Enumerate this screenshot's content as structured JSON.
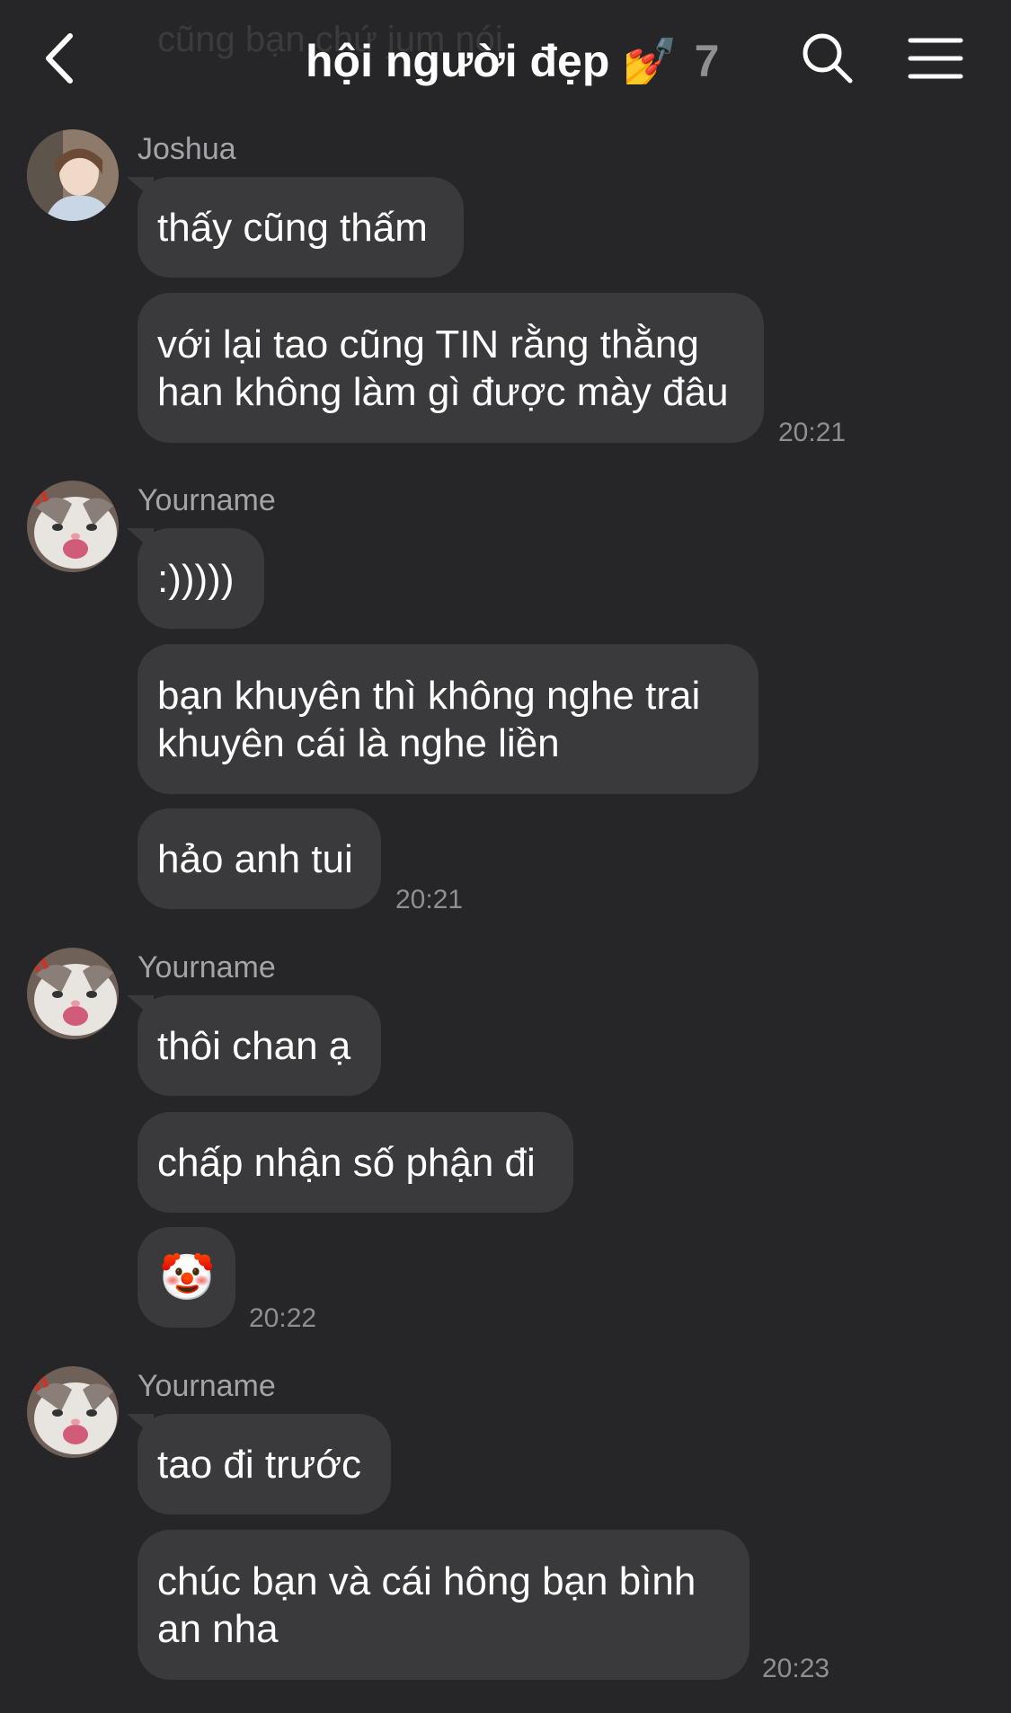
{
  "header": {
    "back_icon": "chevron-left-icon",
    "ghost_text": "cũng bạn chứ jum nói",
    "title": "hội người đẹp",
    "title_emoji": "💅",
    "member_count": "7",
    "search_icon": "search-icon",
    "menu_icon": "hamburger-menu-icon"
  },
  "messages": [
    {
      "sender": "Joshua",
      "bubbles": [
        "thấy cũng thấm",
        "với lại tao cũng TIN rằng thằng han không làm gì được mày đâu"
      ],
      "time": "20:21"
    },
    {
      "sender": "Yourname",
      "bubbles": [
        ":)))))",
        "bạn khuyên thì không nghe trai khuyên cái là nghe liền",
        "hảo anh tui"
      ],
      "time": "20:21"
    },
    {
      "sender": "Yourname",
      "bubbles": [
        "thôi chan ạ",
        "chấp nhận số phận đi",
        "🤡"
      ],
      "time": "20:22"
    },
    {
      "sender": "Yourname",
      "bubbles": [
        "tao đi trước",
        "chúc bạn và cái hông bạn bình an nha"
      ],
      "time": "20:23"
    }
  ],
  "colors": {
    "background": "#262628",
    "bubble": "#3a3a3c",
    "sender": "#a4a4a8",
    "time": "#8e8e93"
  }
}
